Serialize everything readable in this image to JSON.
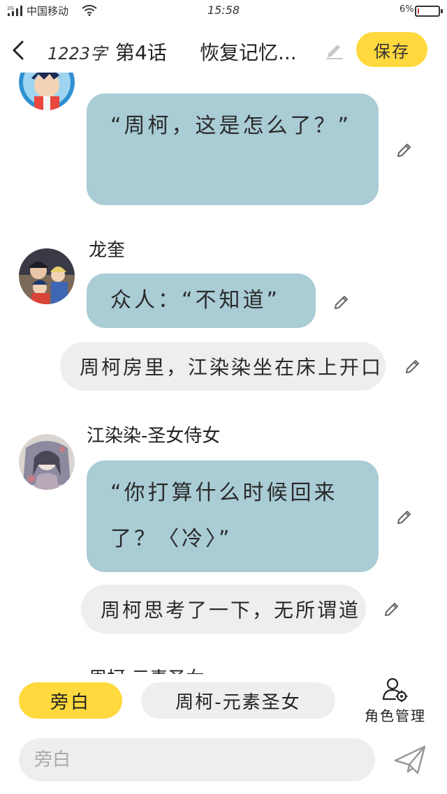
{
  "status_bar": {
    "carrier": "中国移动",
    "time": "15:58",
    "battery_percent": "6%",
    "battery_level": 0.06
  },
  "header": {
    "word_count": "1223字",
    "chapter_no": "第4话",
    "chapter_title": "恢复记忆...",
    "save_label": "保存"
  },
  "messages": [
    {
      "type": "dialogue",
      "speaker": "",
      "avatar_icon": "anime-boy-avatar",
      "text": "“周柯，这是怎么了？”"
    },
    {
      "type": "dialogue",
      "speaker": "龙奎",
      "avatar_icon": "group-avatar",
      "text": "众人：“不知道”"
    },
    {
      "type": "narration",
      "text": "周柯房里，江染染坐在床上开口"
    },
    {
      "type": "dialogue",
      "speaker": "江染染-圣女侍女",
      "avatar_icon": "girl-illustration-avatar",
      "text": "“你打算什么时候回来了？〈冷〉”"
    },
    {
      "type": "narration",
      "text": "周柯思考了一下，无所谓道"
    },
    {
      "type": "partial",
      "speaker": "周柯-元素圣女"
    }
  ],
  "character_bar": {
    "narration_chip": "旁白",
    "current_character_chip": "周柯-元素圣女",
    "role_management_label": "角色管理"
  },
  "input": {
    "placeholder": "旁白",
    "value": ""
  },
  "colors": {
    "accent_yellow": "#ffd93d",
    "dialogue_bubble": "#a9ccd5",
    "narration_bubble": "#eeeeee",
    "battery_low": "#e23b3b"
  }
}
